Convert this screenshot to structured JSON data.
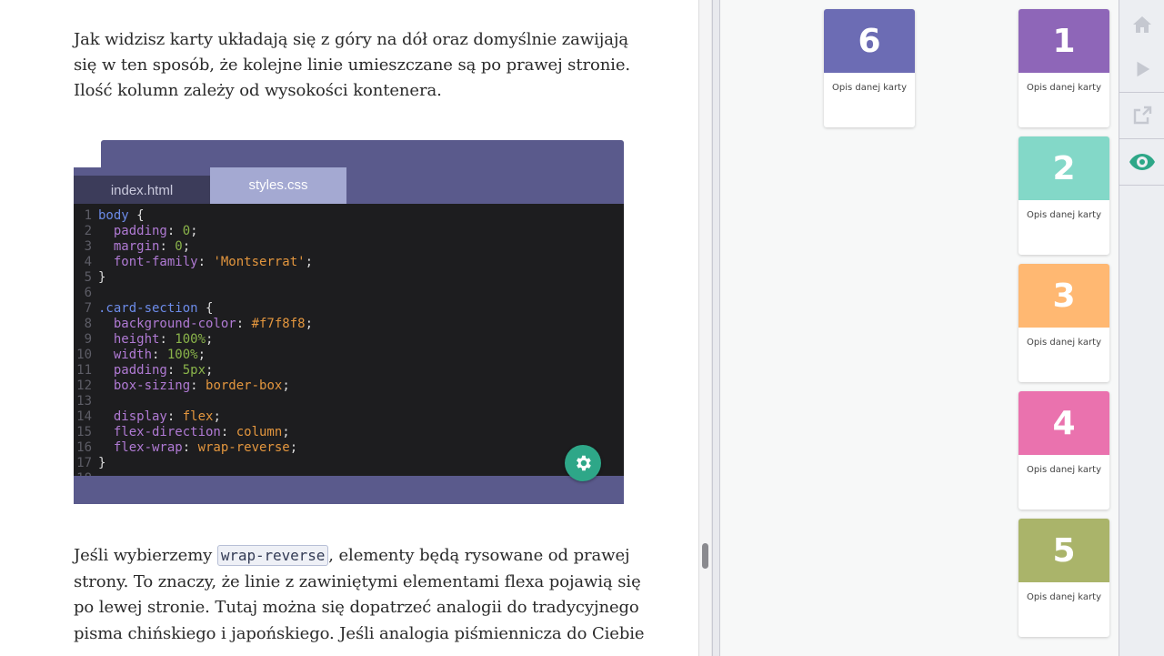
{
  "lesson": {
    "intro_lines": [
      "Jak widzisz karty układają się z góry na dół oraz domyślnie zawijają",
      "się w ten sposób, że kolejne linie umieszczane są po prawej stronie.",
      "Ilość kolumn zależy od wysokości kontenera."
    ],
    "para_before_code": "Jeśli wybierzemy ",
    "inline_code": "wrap-reverse",
    "para_after_code": ", elementy będą rysowane od prawej",
    "body_lines": [
      "strony. To znaczy, że linie z zawiniętymi elementami flexa pojawią się",
      "po lewej stronie. Tutaj można się dopatrzeć analogii do tradycyjnego",
      "pisma chińskiego i japońskiego. Jeśli analogia piśmiennicza do Ciebie"
    ]
  },
  "editor": {
    "tabs": [
      {
        "label": "index.html",
        "active": false
      },
      {
        "label": "styles.css",
        "active": true
      }
    ],
    "code_lines": [
      [
        {
          "t": "body",
          "c": "sel"
        },
        {
          "t": " {",
          "c": "punc"
        }
      ],
      [
        {
          "t": "  padding",
          "c": "prop"
        },
        {
          "t": ": ",
          "c": "punc"
        },
        {
          "t": "0",
          "c": "num"
        },
        {
          "t": ";",
          "c": "punc"
        }
      ],
      [
        {
          "t": "  margin",
          "c": "prop"
        },
        {
          "t": ": ",
          "c": "punc"
        },
        {
          "t": "0",
          "c": "num"
        },
        {
          "t": ";",
          "c": "punc"
        }
      ],
      [
        {
          "t": "  font-family",
          "c": "prop"
        },
        {
          "t": ": ",
          "c": "punc"
        },
        {
          "t": "'Montserrat'",
          "c": "str"
        },
        {
          "t": ";",
          "c": "punc"
        }
      ],
      [
        {
          "t": "}",
          "c": "punc"
        }
      ],
      [],
      [
        {
          "t": ".card-section",
          "c": "sel"
        },
        {
          "t": " {",
          "c": "punc"
        }
      ],
      [
        {
          "t": "  background-color",
          "c": "prop"
        },
        {
          "t": ": ",
          "c": "punc"
        },
        {
          "t": "#f7f8f8",
          "c": "str"
        },
        {
          "t": ";",
          "c": "punc"
        }
      ],
      [
        {
          "t": "  height",
          "c": "prop"
        },
        {
          "t": ": ",
          "c": "punc"
        },
        {
          "t": "100%",
          "c": "num"
        },
        {
          "t": ";",
          "c": "punc"
        }
      ],
      [
        {
          "t": "  width",
          "c": "prop"
        },
        {
          "t": ": ",
          "c": "punc"
        },
        {
          "t": "100%",
          "c": "num"
        },
        {
          "t": ";",
          "c": "punc"
        }
      ],
      [
        {
          "t": "  padding",
          "c": "prop"
        },
        {
          "t": ": ",
          "c": "punc"
        },
        {
          "t": "5px",
          "c": "num"
        },
        {
          "t": ";",
          "c": "punc"
        }
      ],
      [
        {
          "t": "  box-sizing",
          "c": "prop"
        },
        {
          "t": ": ",
          "c": "punc"
        },
        {
          "t": "border-box",
          "c": "str"
        },
        {
          "t": ";",
          "c": "punc"
        }
      ],
      [],
      [
        {
          "t": "  display",
          "c": "prop"
        },
        {
          "t": ": ",
          "c": "punc"
        },
        {
          "t": "flex",
          "c": "str"
        },
        {
          "t": ";",
          "c": "punc"
        }
      ],
      [
        {
          "t": "  flex-direction",
          "c": "prop"
        },
        {
          "t": ": ",
          "c": "punc"
        },
        {
          "t": "column",
          "c": "str"
        },
        {
          "t": ";",
          "c": "punc"
        }
      ],
      [
        {
          "t": "  flex-wrap",
          "c": "prop"
        },
        {
          "t": ": ",
          "c": "punc"
        },
        {
          "t": "wrap-reverse",
          "c": "str"
        },
        {
          "t": ";",
          "c": "punc"
        }
      ],
      [
        {
          "t": "}",
          "c": "punc"
        }
      ],
      []
    ],
    "settings_icon": "gear-icon"
  },
  "preview": {
    "cards": [
      {
        "number": "1",
        "desc": "Opis danej karty",
        "color": "#8e66b8"
      },
      {
        "number": "2",
        "desc": "Opis danej karty",
        "color": "#83d8c8"
      },
      {
        "number": "3",
        "desc": "Opis danej karty",
        "color": "#ffb872"
      },
      {
        "number": "4",
        "desc": "Opis danej karty",
        "color": "#ea72ae"
      },
      {
        "number": "5",
        "desc": "Opis danej karty",
        "color": "#aab46a"
      },
      {
        "number": "6",
        "desc": "Opis danej karty",
        "color": "#6c6cb4"
      }
    ]
  },
  "toolbar": {
    "buttons": [
      "home-icon",
      "play-icon",
      "external-link-icon",
      "eye-icon"
    ],
    "accent": "#2ea788",
    "icon_color": "#c5c8d0"
  }
}
